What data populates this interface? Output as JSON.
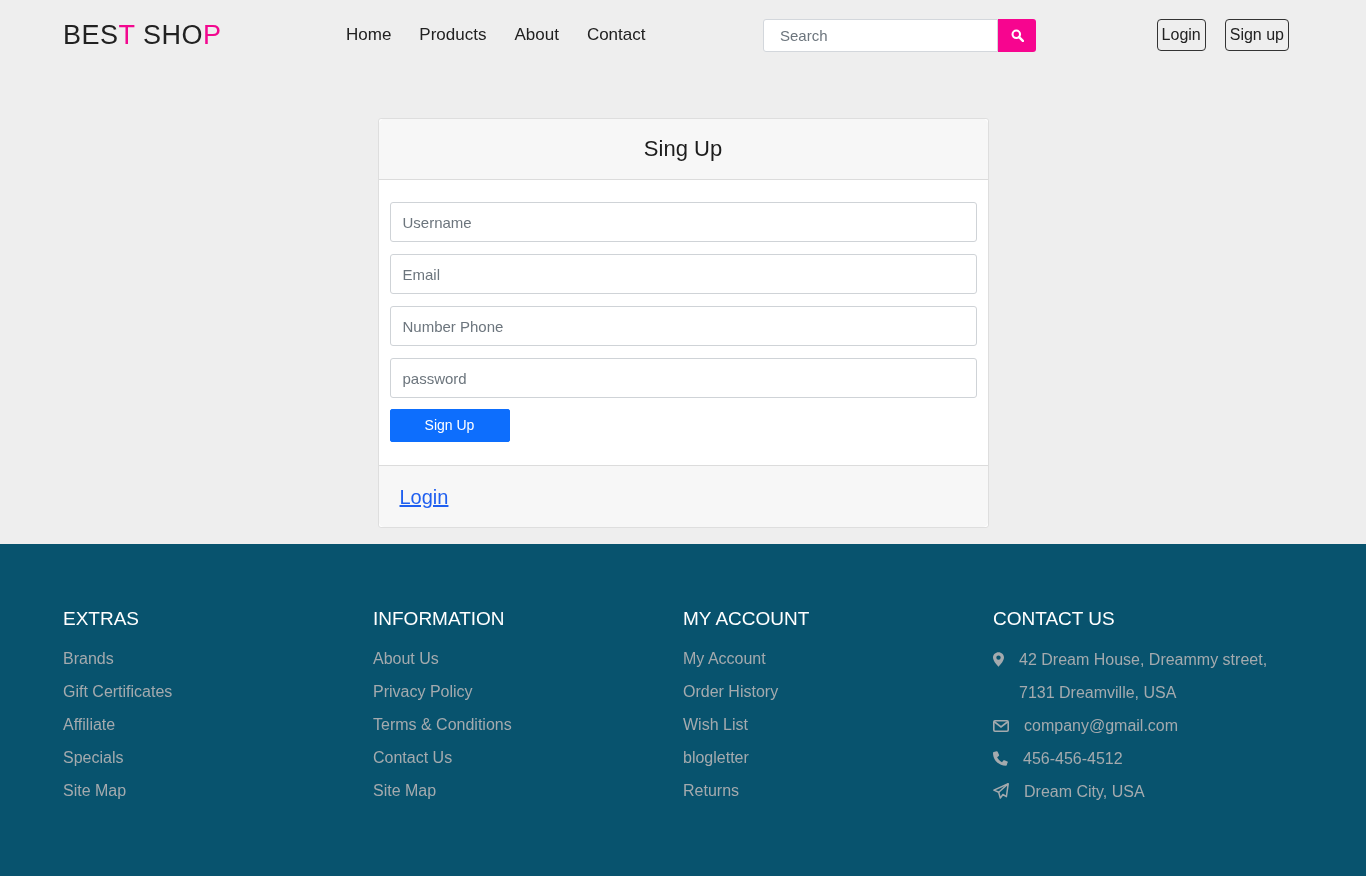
{
  "header": {
    "logo": [
      {
        "text": "BES",
        "accent": false
      },
      {
        "text": "T",
        "accent": true
      },
      {
        "text": " SHO",
        "accent": false
      },
      {
        "text": "P",
        "accent": true
      }
    ],
    "nav_links": [
      "Home",
      "Products",
      "About",
      "Contact"
    ],
    "search": {
      "placeholder": "Search"
    },
    "buttons": [
      "Login",
      "Sign up"
    ]
  },
  "signup_card": {
    "title": "Sing Up",
    "fields": [
      {
        "placeholder": "Username"
      },
      {
        "placeholder": "Email"
      },
      {
        "placeholder": "Number Phone"
      },
      {
        "placeholder": "password"
      }
    ],
    "submit": "Sign Up",
    "footer_link": "Login"
  },
  "footer": {
    "columns": [
      {
        "heading": "EXTRAS",
        "links": [
          "Brands",
          "Gift Certificates",
          "Affiliate",
          "Specials",
          "Site Map"
        ]
      },
      {
        "heading": "INFORMATION",
        "links": [
          "About Us",
          "Privacy Policy",
          "Terms & Conditions",
          "Contact Us",
          "Site Map"
        ]
      },
      {
        "heading": "MY ACCOUNT",
        "links": [
          "My Account",
          "Order History",
          "Wish List",
          "blogletter",
          "Returns"
        ]
      }
    ],
    "contact": {
      "heading": "CONTACT US",
      "items": [
        {
          "kind": "address",
          "lines": [
            "42 Dream House, Dreammy street,",
            "7131 Dreamville, USA"
          ]
        },
        {
          "kind": "email",
          "lines": [
            "company@gmail.com"
          ]
        },
        {
          "kind": "phone",
          "lines": [
            "456-456-4512"
          ]
        },
        {
          "kind": "location",
          "lines": [
            "Dream City, USA"
          ]
        }
      ]
    }
  }
}
